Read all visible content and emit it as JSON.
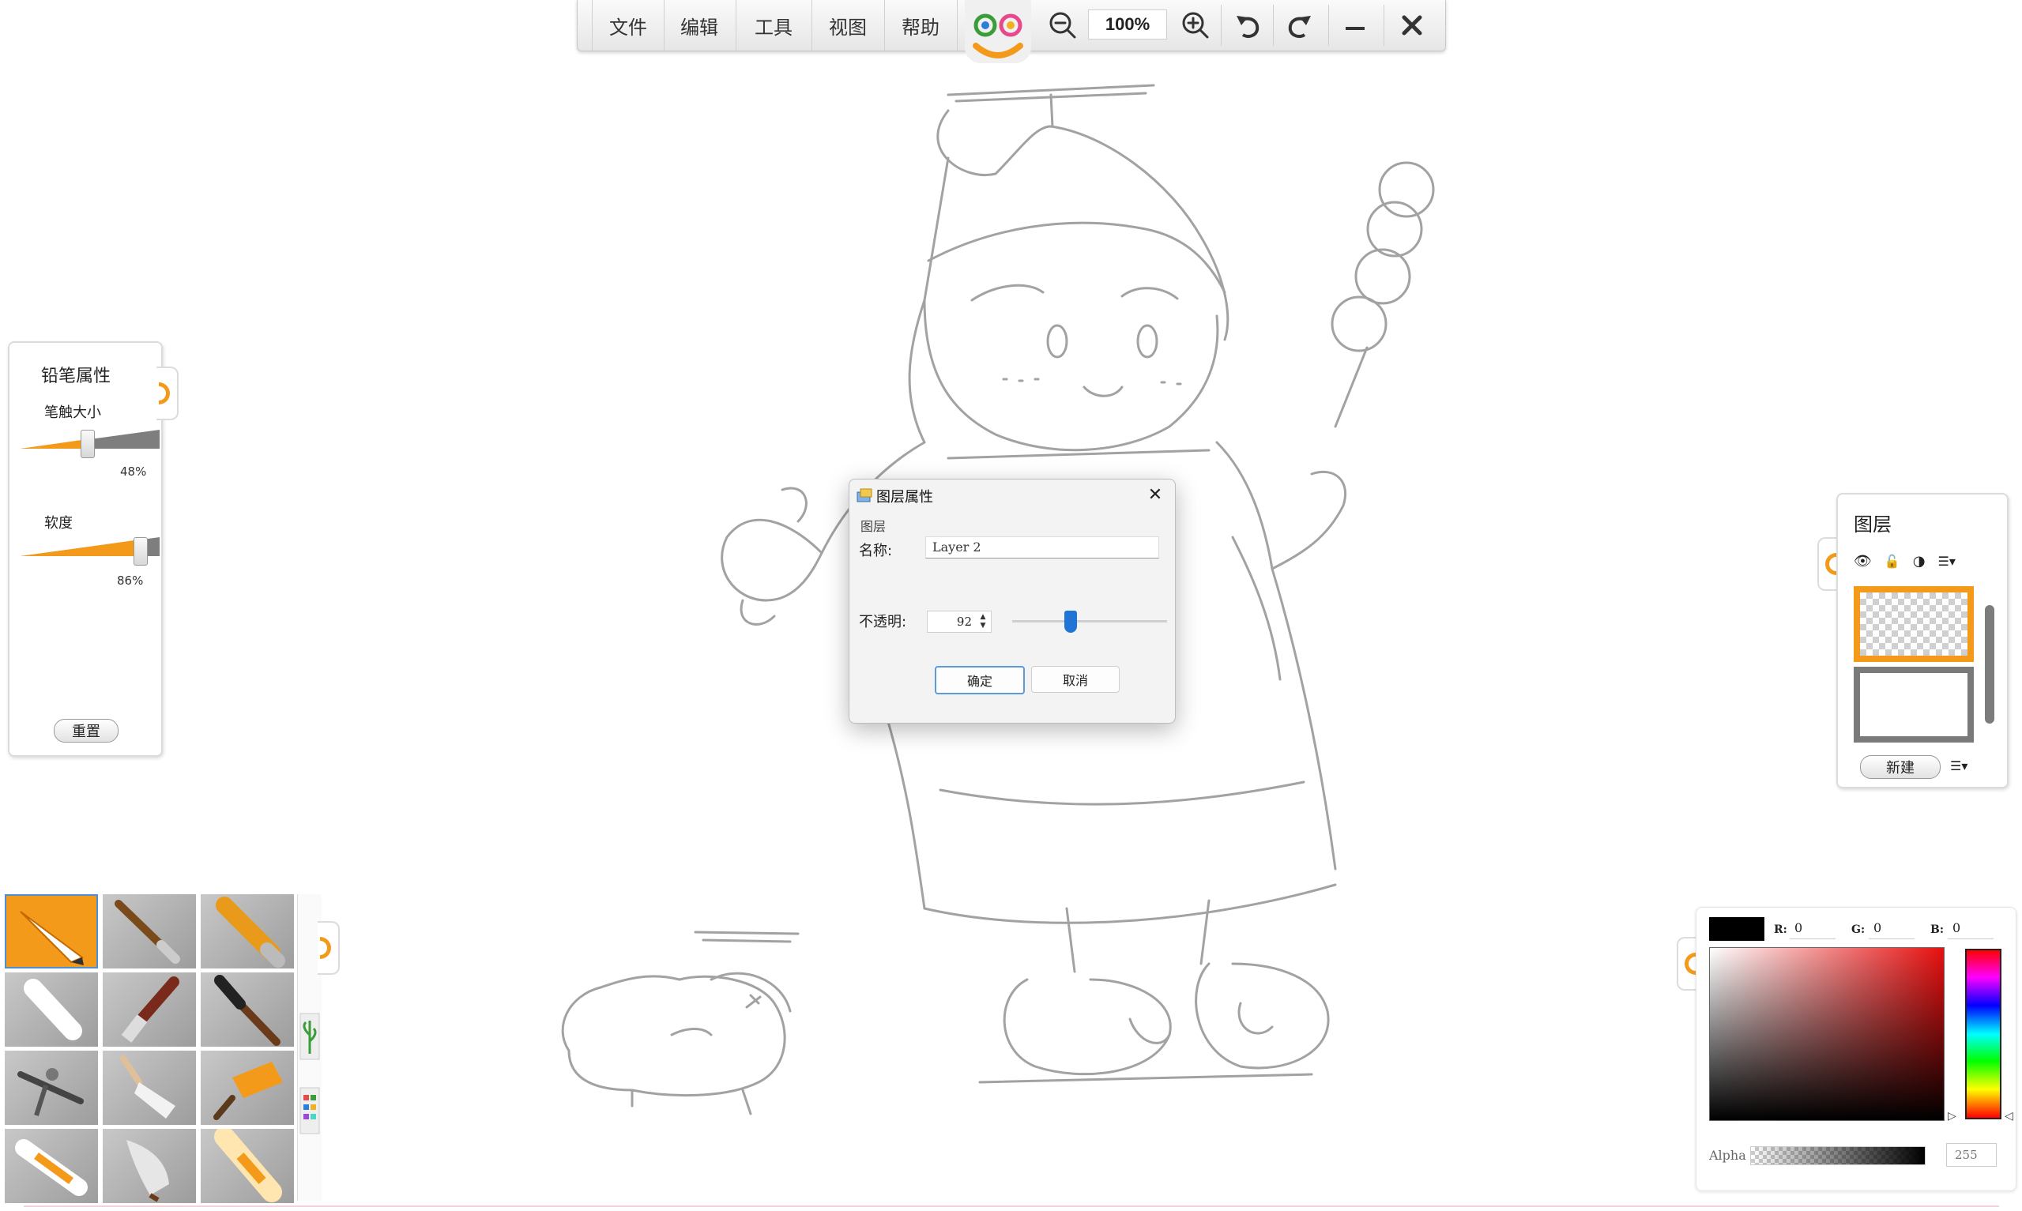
{
  "menu": [
    "文件",
    "编辑",
    "工具",
    "视图",
    "帮助"
  ],
  "toolbar": {
    "zoom_level": "100%"
  },
  "icons": {
    "zoom_out": "zoom-out-icon",
    "zoom_in": "zoom-in-icon",
    "undo": "undo-icon",
    "redo": "redo-icon",
    "minimize": "minimize-icon",
    "close": "close-icon"
  },
  "pencil_panel": {
    "title": "铅笔属性",
    "size_label": "笔触大小",
    "size_value": "48%",
    "size_level": 0.48,
    "softness_label": "软度",
    "softness_value": "86%",
    "softness_level": 0.86,
    "reset_label": "重置"
  },
  "brushes": [
    "pencil",
    "brush",
    "marker",
    "eraser",
    "flat-brush",
    "ink-brush",
    "airbrush",
    "palette-knife",
    "roller",
    "crayon",
    "nib",
    "highlighter"
  ],
  "dialog": {
    "title": "图层属性",
    "group_label": "图层",
    "name_label": "名称:",
    "name_value": "Layer 2",
    "opacity_label": "不透明:",
    "opacity_value": "92",
    "ok_label": "确定",
    "cancel_label": "取消"
  },
  "layers_panel": {
    "title": "图层",
    "new_label": "新建"
  },
  "color_panel": {
    "swatch_color": "#000000",
    "r_label": "R:",
    "r_value": "0",
    "g_label": "G:",
    "g_value": "0",
    "b_label": "B:",
    "b_value": "0",
    "alpha_label": "Alpha",
    "alpha_value": "255"
  },
  "colors": {
    "accent": "#f39a1b",
    "dialog_thumb": "#1f74d6",
    "sketch": "#9a9a9a"
  }
}
